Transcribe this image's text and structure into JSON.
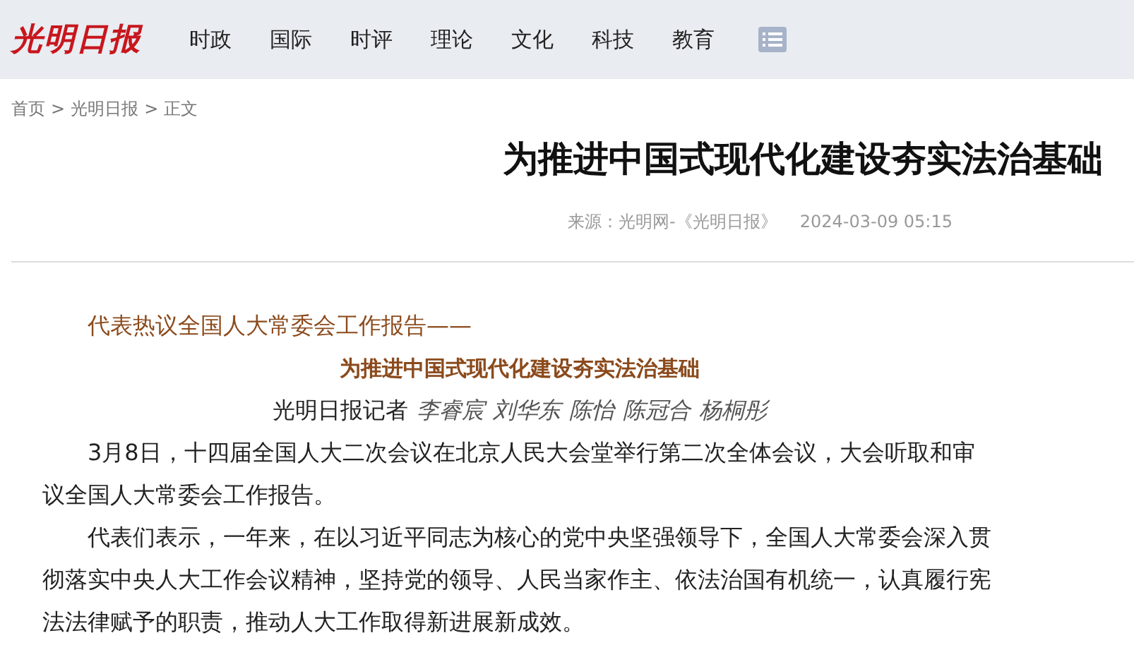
{
  "header": {
    "logo": "光明日报",
    "nav": [
      {
        "label": "时政"
      },
      {
        "label": "国际"
      },
      {
        "label": "时评"
      },
      {
        "label": "理论"
      },
      {
        "label": "文化"
      },
      {
        "label": "科技"
      },
      {
        "label": "教育"
      }
    ]
  },
  "breadcrumb": [
    {
      "label": "首页",
      "sep": ">"
    },
    {
      "label": "光明日报",
      "sep": ">"
    },
    {
      "label": "正文"
    }
  ],
  "article": {
    "title": "为推进中国式现代化建设夯实法治基础",
    "source": "来源：光明网-《光明日报》",
    "time": "2024-03-09 05:15",
    "lead": "代表热议全国人大常委会工作报告——",
    "subtitle": "为推进中国式现代化建设夯实法治基础",
    "byline": {
      "label": "光明日报记者",
      "names": [
        "李睿宸",
        "刘华东",
        "陈怡",
        "陈冠合",
        "杨桐彤"
      ]
    },
    "paragraphs": [
      "3月8日，十四届全国人大二次会议在北京人民大会堂举行第二次全体会议，大会听取和审议全国人大常委会工作报告。",
      "代表们表示，一年来，在以习近平同志为核心的党中央坚强领导下，全国人大常委会深入贯彻落实中央人大工作会议精神，坚持党的领导、人民当家作主、依法治国有机统一，认真履行宪法法律赋予的职责，推动人大工作取得新进展新成效。"
    ]
  }
}
